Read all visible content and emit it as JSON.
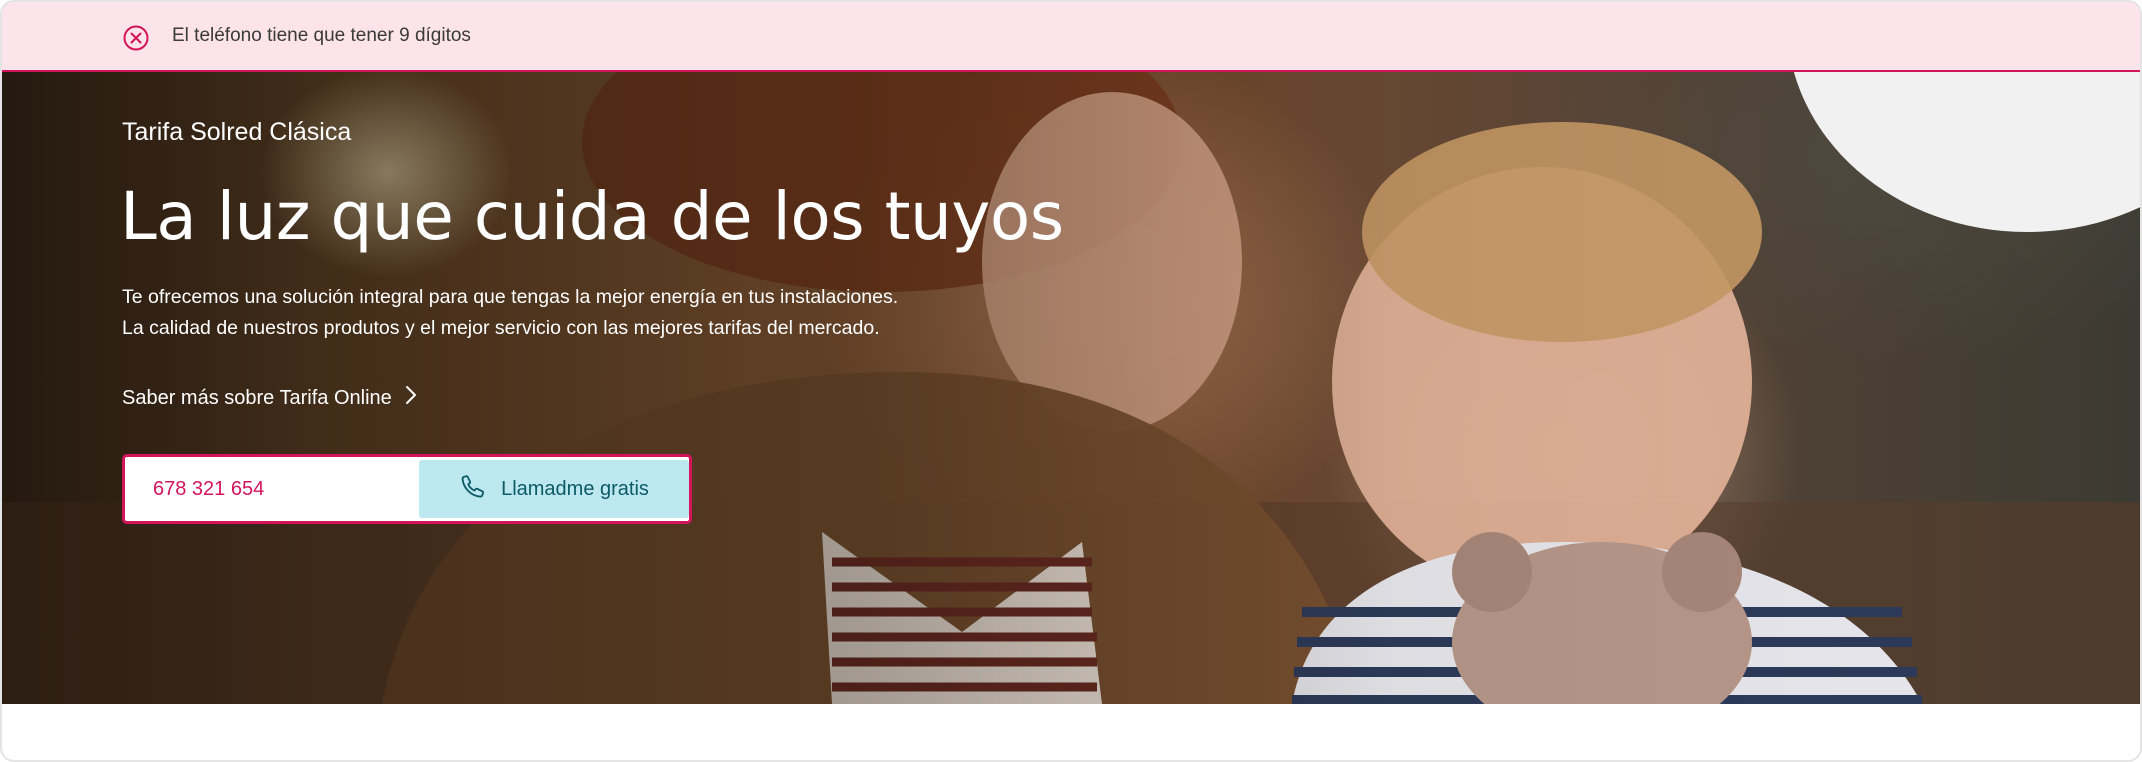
{
  "error_banner": {
    "icon": "close-circle-icon",
    "message": "El teléfono tiene que tener 9 dígitos"
  },
  "hero": {
    "eyebrow": "Tarifa Solred Clásica",
    "headline": "La luz que cuida de los tuyos",
    "description_line1": "Te ofrecemos una solución integral para que tengas la mejor energía en tus instalaciones.",
    "description_line2": "La calidad de nuestros produtos y el mejor servicio con las mejores tarifas del mercado.",
    "more_link": "Saber más sobre Tarifa Online",
    "more_link_icon": "chevron-right-icon"
  },
  "callback_form": {
    "phone_value": "678 321 654",
    "button_label": "Llamadme gratis",
    "button_icon": "phone-icon"
  },
  "colors": {
    "accent": "#d4145a",
    "error_bg": "#fce4ea",
    "button_bg": "#bde8ef",
    "button_text": "#0b5a66"
  }
}
